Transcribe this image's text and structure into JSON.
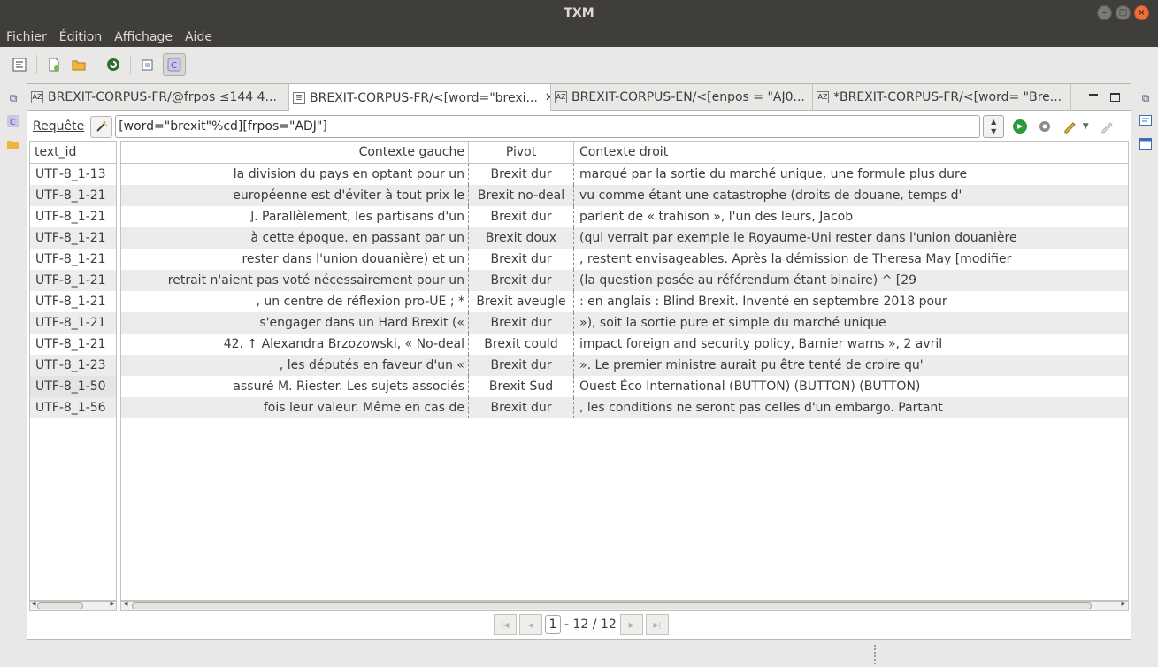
{
  "window": {
    "title": "TXM"
  },
  "menu": [
    "Fichier",
    "Édition",
    "Affichage",
    "Aide"
  ],
  "tabs": [
    {
      "label": "BREXIT-CORPUS-FR/@frpos ≤144 4...",
      "icon": "lexicon-az-icon"
    },
    {
      "label": "BREXIT-CORPUS-FR/<[word=\"brexi...",
      "icon": "concordance-icon",
      "active": true
    },
    {
      "label": "BREXIT-CORPUS-EN/<[enpos = \"AJ0...",
      "icon": "lexicon-az-icon"
    },
    {
      "label": "*BREXIT-CORPUS-FR/<[word= \"Bre...",
      "icon": "lexicon-az-icon"
    }
  ],
  "query": {
    "label": "Requête",
    "value": "[word=\"brexit\"%cd][frpos=\"ADJ\"]"
  },
  "columns": {
    "id": "text_id",
    "left": "Contexte gauche",
    "pivot": "Pivot",
    "right": "Contexte droit"
  },
  "rows": [
    {
      "id": "UTF-8_1-13",
      "left": "la division du pays en optant pour un",
      "pivot": "Brexit dur",
      "right": "marqué par la sortie du marché unique, une formule plus dure"
    },
    {
      "id": "UTF-8_1-21",
      "left": "européenne est d'éviter à tout prix le",
      "pivot": "Brexit no-deal",
      "right": "vu comme étant une catastrophe (droits de douane, temps d'"
    },
    {
      "id": "UTF-8_1-21",
      "left": "]. Parallèlement, les partisans d'un",
      "pivot": "Brexit dur",
      "right": "parlent de « trahison », l'un des leurs, Jacob"
    },
    {
      "id": "UTF-8_1-21",
      "left": "à cette époque. en passant par un",
      "pivot": "Brexit doux",
      "right": "(qui verrait par exemple le Royaume-Uni rester dans l'union douanière"
    },
    {
      "id": "UTF-8_1-21",
      "left": "rester dans l'union douanière) et un",
      "pivot": "Brexit dur",
      "right": ", restent envisageables. Après la démission de Theresa May [modifier"
    },
    {
      "id": "UTF-8_1-21",
      "left": "retrait n'aient pas voté nécessairement pour un",
      "pivot": "Brexit dur",
      "right": "(la question posée au référendum étant binaire) ^ [29"
    },
    {
      "id": "UTF-8_1-21",
      "left": ", un centre de réflexion pro-UE ; *",
      "pivot": "Brexit aveugle",
      "right": ": en anglais : Blind Brexit. Inventé en septembre 2018 pour"
    },
    {
      "id": "UTF-8_1-21",
      "left": "s'engager dans un Hard Brexit («",
      "pivot": "Brexit dur",
      "right": "»), soit la sortie pure et simple du marché unique"
    },
    {
      "id": "UTF-8_1-21",
      "left": "42. ↑ Alexandra Brzozowski, « No-deal",
      "pivot": "Brexit could",
      "right": "impact foreign and security policy, Barnier warns », 2 avril"
    },
    {
      "id": "UTF-8_1-23",
      "left": ", les députés en faveur d'un «",
      "pivot": "Brexit dur",
      "right": "». Le premier ministre aurait pu être tenté de croire qu'"
    },
    {
      "id": "UTF-8_1-50",
      "left": "assuré M. Riester. Les sujets associés",
      "pivot": "Brexit Sud",
      "right": "Ouest Éco International (BUTTON) (BUTTON) (BUTTON)"
    },
    {
      "id": "UTF-8_1-56",
      "left": "fois leur valeur. Même en cas de",
      "pivot": "Brexit dur",
      "right": ", les conditions ne seront pas celles d'un embargo. Partant"
    }
  ],
  "pager": {
    "page": "1",
    "summary": "- 12 / 12"
  }
}
